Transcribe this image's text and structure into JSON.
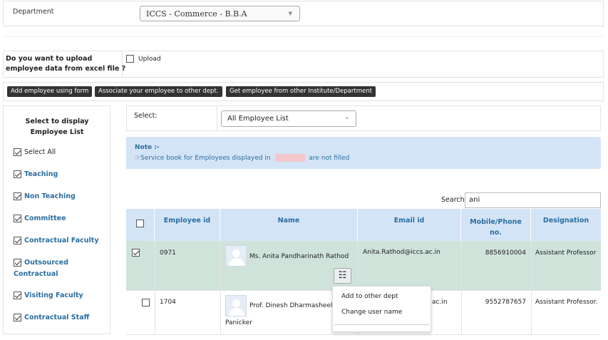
{
  "department": {
    "label": "Department",
    "selected": "ICCS - Commerce - B.B.A"
  },
  "upload": {
    "question_line1": "Do you want to upload",
    "question_line2": "employee data from excel file ?",
    "checkbox_label": "Upload"
  },
  "actions": {
    "add_form": "Add employee using form",
    "associate": "Associate your employee to other dept.",
    "get_other": "Get employee from other Institute/Department"
  },
  "sidebar": {
    "title_line1": "Select to display",
    "title_line2": "Employee List",
    "items": [
      {
        "label": "Select All",
        "checked": true
      },
      {
        "label": "Teaching",
        "checked": true
      },
      {
        "label": "Non Teaching",
        "checked": true
      },
      {
        "label": "Committee",
        "checked": true
      },
      {
        "label": "Contractual Faculty",
        "checked": true
      },
      {
        "label_line1": "Outsourced",
        "label_line2": "Contractual",
        "checked": true
      },
      {
        "label": "Visiting Faculty",
        "checked": true
      },
      {
        "label": "Contractual Staff",
        "checked": true
      }
    ]
  },
  "filter": {
    "label": "Select:",
    "value": "All Employee List"
  },
  "note": {
    "title": "Note :-",
    "text_before": "Service book for Employees displayed in",
    "text_after": "are not filled",
    "highlight_color": "#f4c7cc"
  },
  "search": {
    "label": "Search:",
    "value": "ani"
  },
  "table": {
    "headers": {
      "employee_id": "Employee id",
      "name": "Name",
      "email": "Email id",
      "mobile_line1": "Mobile/Phone",
      "mobile_line2": "no.",
      "designation": "Designation"
    },
    "rows": [
      {
        "id": "0971",
        "name": "Ms. Anita Pandharinath Rathod",
        "email": "Anita.Rathod@iccs.ac.in",
        "mobile": "8856910004",
        "designation": "Assistant Professor",
        "selected": true
      },
      {
        "id": "1704",
        "name_line1": "Prof. Dinesh Dharmasheelan",
        "name_line2": "Panicker",
        "email_partial": "ac.in",
        "mobile": "9552787657",
        "designation": "Assistant Professor.",
        "selected": false
      }
    ]
  },
  "context_menu": {
    "items": [
      "Add to other dept",
      "Change user name"
    ]
  },
  "colors": {
    "header_bg": "#d4e4f7",
    "header_text": "#2a6ea0",
    "selected_row": "#cfe3db",
    "dark_button": "#333333"
  }
}
